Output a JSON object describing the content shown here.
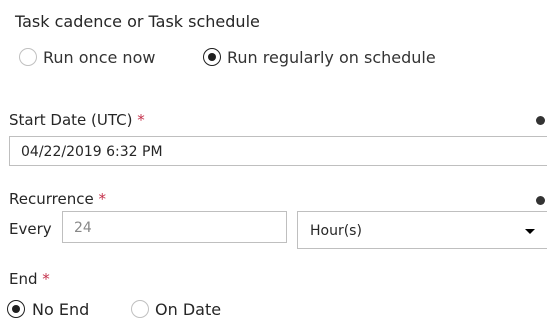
{
  "task_cadence": {
    "label": "Task cadence or Task schedule",
    "options": [
      {
        "label": "Run once now",
        "selected": false
      },
      {
        "label": "Run regularly on schedule",
        "selected": true
      }
    ]
  },
  "start_date": {
    "label": "Start Date (UTC)",
    "required_mark": "*",
    "value": "04/22/2019 6:32 PM"
  },
  "recurrence": {
    "label": "Recurrence",
    "required_mark": "*",
    "every_label": "Every",
    "interval_value": "24",
    "unit_value": "Hour(s)"
  },
  "end": {
    "label": "End",
    "required_mark": "*",
    "options": [
      {
        "label": "No End",
        "selected": true
      },
      {
        "label": "On Date",
        "selected": false
      }
    ]
  },
  "colors": {
    "required": "#c4314b",
    "text": "#262626",
    "border": "#bfbfbf"
  },
  "icons": [
    "info-icon",
    "chevron-down-icon"
  ]
}
